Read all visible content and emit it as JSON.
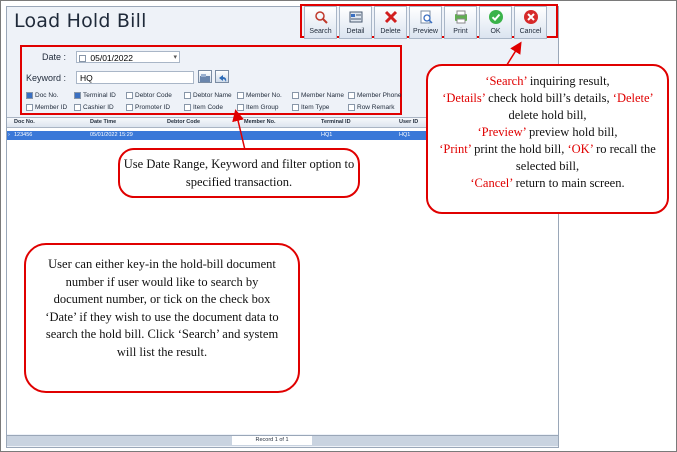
{
  "window": {
    "title": "Load Hold Bill"
  },
  "toolbar": {
    "buttons": [
      {
        "label": "Search",
        "icon": "search-icon"
      },
      {
        "label": "Detail",
        "icon": "detail-icon"
      },
      {
        "label": "Delete",
        "icon": "delete-icon"
      },
      {
        "label": "Preview",
        "icon": "preview-icon"
      },
      {
        "label": "Print",
        "icon": "print-icon"
      },
      {
        "label": "OK",
        "icon": "ok-icon"
      },
      {
        "label": "Cancel",
        "icon": "cancel-icon"
      }
    ]
  },
  "filter": {
    "date_label": "Date :",
    "date_value": "05/01/2022",
    "keyword_label": "Keyword :",
    "keyword_value": "HQ",
    "options_row1": [
      {
        "label": "Doc No.",
        "checked": true
      },
      {
        "label": "Terminal ID",
        "checked": true
      },
      {
        "label": "Debtor Code",
        "checked": false
      },
      {
        "label": "Debtor Name",
        "checked": false
      },
      {
        "label": "Member No.",
        "checked": false
      },
      {
        "label": "Member Name",
        "checked": false
      },
      {
        "label": "Member Phone",
        "checked": false
      }
    ],
    "options_row2": [
      {
        "label": "Member ID",
        "checked": false
      },
      {
        "label": "Cashier ID",
        "checked": false
      },
      {
        "label": "Promoter ID",
        "checked": false
      },
      {
        "label": "Item Code",
        "checked": false
      },
      {
        "label": "Item Group",
        "checked": false
      },
      {
        "label": "Item Type",
        "checked": false
      },
      {
        "label": "Row Remark",
        "checked": false
      }
    ]
  },
  "grid": {
    "columns": [
      "Doc No.",
      "Date Time",
      "Debtor Code",
      "Member No.",
      "Terminal ID",
      "User ID"
    ],
    "rows": [
      [
        "123456",
        "05/01/2022 15:29",
        "",
        "",
        "HQ1",
        "HQ1"
      ]
    ]
  },
  "status": {
    "record": "Record 1 of 1"
  },
  "callouts": {
    "filter_text": "Use Date Range, Keyword and filter option to specified transaction.",
    "search_text": "User can either key-in the hold-bill document number if user would like to search by document number, or tick on the check box ‘Date’ if they wish to use the document data to search the hold bill. Click ‘Search’ and system will list the result.",
    "buttons": {
      "search_term": "‘Search’",
      "search_desc": " inquiring result,",
      "details_term": "‘Details’",
      "details_desc": " check hold bill’s details, ",
      "delete_term": "‘Delete’",
      "delete_desc": " delete hold bill,",
      "preview_term": "‘Preview’",
      "preview_desc": " preview hold bill,",
      "print_term": "‘Print’",
      "print_desc": " print the hold bill, ",
      "ok_term": "‘OK’",
      "ok_desc": " ro recall the selected bill,",
      "cancel_term": "‘Cancel’",
      "cancel_desc": " return to main screen."
    }
  },
  "colors": {
    "accent_red": "#e00000",
    "selection_blue": "#3a78d8"
  }
}
